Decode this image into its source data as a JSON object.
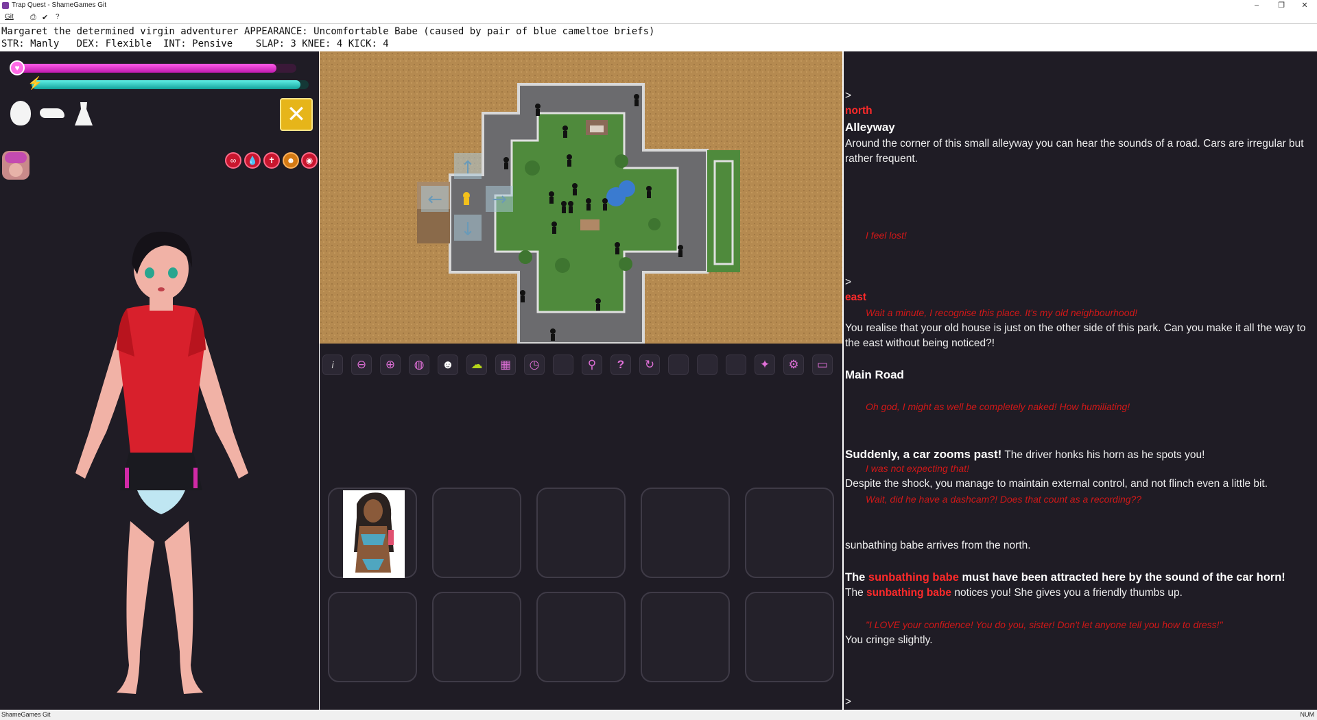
{
  "window": {
    "title": "Trap Quest - ShameGames Git",
    "minimize": "–",
    "restore": "❐",
    "close": "✕"
  },
  "menubar": {
    "git": "Git",
    "help": "?"
  },
  "status": {
    "line1": "Margaret the determined virgin adventurer APPEARANCE: Uncomfortable Babe (caused by pair of blue cameltoe briefs)",
    "line2": "STR: Manly   DEX: Flexible  INT: Pensive    SLAP: 3 KNEE: 4 KICK: 4"
  },
  "stats": {
    "health_fraction": 0.93,
    "fatigue_fraction": 0.97,
    "health_color": "#e02fd0",
    "fatigue_color": "#2fc7bf"
  },
  "toolbar": {
    "buttons": [
      "info",
      "zoom-out",
      "zoom-in",
      "globe",
      "mask",
      "brain",
      "inventory-grid",
      "clock",
      "empty",
      "map-pin",
      "help",
      "refresh",
      "empty",
      "empty",
      "empty",
      "pineapple",
      "settings",
      "screen"
    ],
    "info_label": "i",
    "help_label": "?"
  },
  "inventory": {
    "slots": 10,
    "filled": [
      "sunbathing babe"
    ]
  },
  "log": {
    "prompt1": ">",
    "cmd1": "north",
    "room1": "Alleyway",
    "desc1": "Around the corner of this small alleyway you can hear the sounds of a road. Cars are irregular but rather frequent.",
    "thought1": "I feel lost!",
    "prompt2": ">",
    "cmd2": "east",
    "thought2": "Wait a minute, I recognise this place. It's my old neighbourhood!",
    "desc2": "You realise that your old house is just on the other side of this park. Can you make it all the way to the east without being noticed?!",
    "room2": "Main Road",
    "thought3": "Oh god, I might as well be completely naked! How humiliating!",
    "event1_bold": "Suddenly, a car zooms past!",
    "event1_rest": " The driver honks his horn as he spots you!",
    "thought4": "I was not expecting that!",
    "event2": "Despite the shock, you manage to maintain external control, and not flinch even a little bit.",
    "thought5": "Wait, did he have a dashcam?! Does that count as a recording??",
    "arrive": "sunbathing babe arrives from the north.",
    "attract_pre": "The ",
    "attract_npc": "sunbathing babe",
    "attract_post": " must have been attracted here by the sound of the car horn!",
    "notice_pre": "The ",
    "notice_npc": "sunbathing babe",
    "notice_post": " notices you! She gives you a friendly thumbs up.",
    "quote": "\"I LOVE your confidence! You do you, sister! Don't let anyone tell you how to dress!\"",
    "cringe": "You cringe slightly.",
    "prompt3": ">"
  },
  "statusbar": {
    "left": "ShameGames Git",
    "right": "NUM"
  }
}
